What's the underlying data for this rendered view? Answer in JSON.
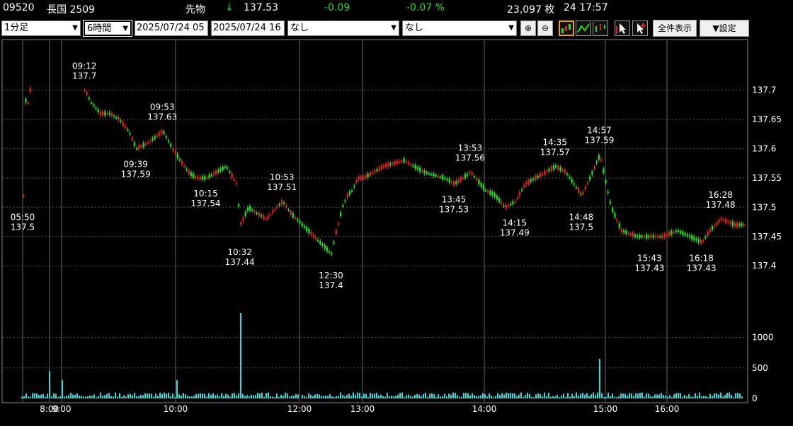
{
  "header": {
    "code": "09520",
    "name": "長国 2509",
    "category": "先物",
    "arrow": "↓",
    "price": "137.53",
    "change": "-0.09",
    "change_pct": "-0.07 %",
    "volume": "23,097 枚",
    "datetime": "24 17:57"
  },
  "controls": {
    "interval": "1分足",
    "span": "6時間",
    "date_from": "2025/07/24 05",
    "date_to": "2025/07/24 16",
    "indicator1": "なし",
    "indicator2": "なし",
    "show_all_label": "全件表示",
    "settings_label": "▼設定"
  },
  "colors": {
    "up": "#e02020",
    "down": "#22dd22",
    "volume": "#33dddd",
    "grid": "#555555",
    "background": "#000000"
  },
  "chart_data": {
    "type": "candlestick",
    "title": "",
    "ylim": [
      137.36,
      137.74
    ],
    "y_ticks": [
      137.4,
      137.45,
      137.5,
      137.55,
      137.6,
      137.65,
      137.7
    ],
    "volume_ticks": [
      0,
      500,
      1000
    ],
    "x_ticks": [
      "8:00",
      "9:00",
      "10:00",
      "12:00",
      "13:00",
      "14:00",
      "15:00",
      "16:00"
    ],
    "price_path": [
      [
        "05:50",
        137.52
      ],
      [
        "05:52",
        137.58
      ],
      [
        "05:55",
        137.64
      ],
      [
        "06:00",
        137.68
      ],
      [
        "06:05",
        137.69
      ],
      [
        "06:10",
        137.67
      ],
      [
        "06:15",
        137.69
      ],
      [
        "06:20",
        137.7
      ],
      [
        "09:12",
        137.7
      ],
      [
        "09:15",
        137.68
      ],
      [
        "09:20",
        137.66
      ],
      [
        "09:25",
        137.66
      ],
      [
        "09:30",
        137.65
      ],
      [
        "09:35",
        137.63
      ],
      [
        "09:39",
        137.6
      ],
      [
        "09:45",
        137.61
      ],
      [
        "09:53",
        137.63
      ],
      [
        "09:58",
        137.6
      ],
      [
        "10:02",
        137.58
      ],
      [
        "10:06",
        137.56
      ],
      [
        "10:10",
        137.55
      ],
      [
        "10:15",
        137.55
      ],
      [
        "10:20",
        137.56
      ],
      [
        "10:25",
        137.57
      ],
      [
        "10:30",
        137.54
      ],
      [
        "10:32",
        137.47
      ],
      [
        "10:36",
        137.5
      ],
      [
        "10:40",
        137.49
      ],
      [
        "10:45",
        137.48
      ],
      [
        "10:50",
        137.5
      ],
      [
        "10:53",
        137.51
      ],
      [
        "10:57",
        137.49
      ],
      [
        "12:30",
        137.42
      ],
      [
        "12:33",
        137.45
      ],
      [
        "12:36",
        137.47
      ],
      [
        "12:40",
        137.5
      ],
      [
        "12:45",
        137.52
      ],
      [
        "12:50",
        137.53
      ],
      [
        "12:55",
        137.55
      ],
      [
        "13:00",
        137.55
      ],
      [
        "13:10",
        137.57
      ],
      [
        "13:20",
        137.58
      ],
      [
        "13:30",
        137.56
      ],
      [
        "13:40",
        137.55
      ],
      [
        "13:45",
        137.54
      ],
      [
        "13:53",
        137.56
      ],
      [
        "14:00",
        137.53
      ],
      [
        "14:05",
        137.52
      ],
      [
        "14:10",
        137.5
      ],
      [
        "14:15",
        137.51
      ],
      [
        "14:20",
        137.54
      ],
      [
        "14:25",
        137.55
      ],
      [
        "14:35",
        137.57
      ],
      [
        "14:40",
        137.56
      ],
      [
        "14:44",
        137.54
      ],
      [
        "14:48",
        137.52
      ],
      [
        "14:52",
        137.55
      ],
      [
        "14:57",
        137.59
      ],
      [
        "15:00",
        137.54
      ],
      [
        "15:05",
        137.5
      ],
      [
        "15:10",
        137.48
      ],
      [
        "15:15",
        137.46
      ],
      [
        "15:30",
        137.45
      ],
      [
        "15:43",
        137.45
      ],
      [
        "15:55",
        137.45
      ],
      [
        "16:05",
        137.46
      ],
      [
        "16:18",
        137.44
      ],
      [
        "16:22",
        137.46
      ],
      [
        "16:28",
        137.48
      ],
      [
        "16:35",
        137.47
      ],
      [
        "16:40",
        137.47
      ]
    ],
    "volume_spikes": [
      [
        "8:00",
        450
      ],
      [
        "9:00",
        300
      ],
      [
        "10:00",
        300
      ],
      [
        "10:32",
        1400
      ],
      [
        "12:00",
        420
      ],
      [
        "14:57",
        650
      ],
      [
        "16:40",
        200
      ]
    ],
    "annotations": [
      {
        "time": "05:50",
        "value": "137.5"
      },
      {
        "time": "09:12",
        "value": "137.7"
      },
      {
        "time": "09:39",
        "value": "137.59"
      },
      {
        "time": "09:53",
        "value": "137.63"
      },
      {
        "time": "10:15",
        "value": "137.54"
      },
      {
        "time": "10:32",
        "value": "137.44"
      },
      {
        "time": "10:53",
        "value": "137.51"
      },
      {
        "time": "12:30",
        "value": "137.4"
      },
      {
        "time": "13:45",
        "value": "137.53"
      },
      {
        "time": "13:53",
        "value": "137.56"
      },
      {
        "time": "14:15",
        "value": "137.49"
      },
      {
        "time": "14:35",
        "value": "137.57"
      },
      {
        "time": "14:48",
        "value": "137.5"
      },
      {
        "time": "14:57",
        "value": "137.59"
      },
      {
        "time": "15:43",
        "value": "137.43"
      },
      {
        "time": "16:18",
        "value": "137.43"
      },
      {
        "time": "16:28",
        "value": "137.48"
      }
    ]
  }
}
